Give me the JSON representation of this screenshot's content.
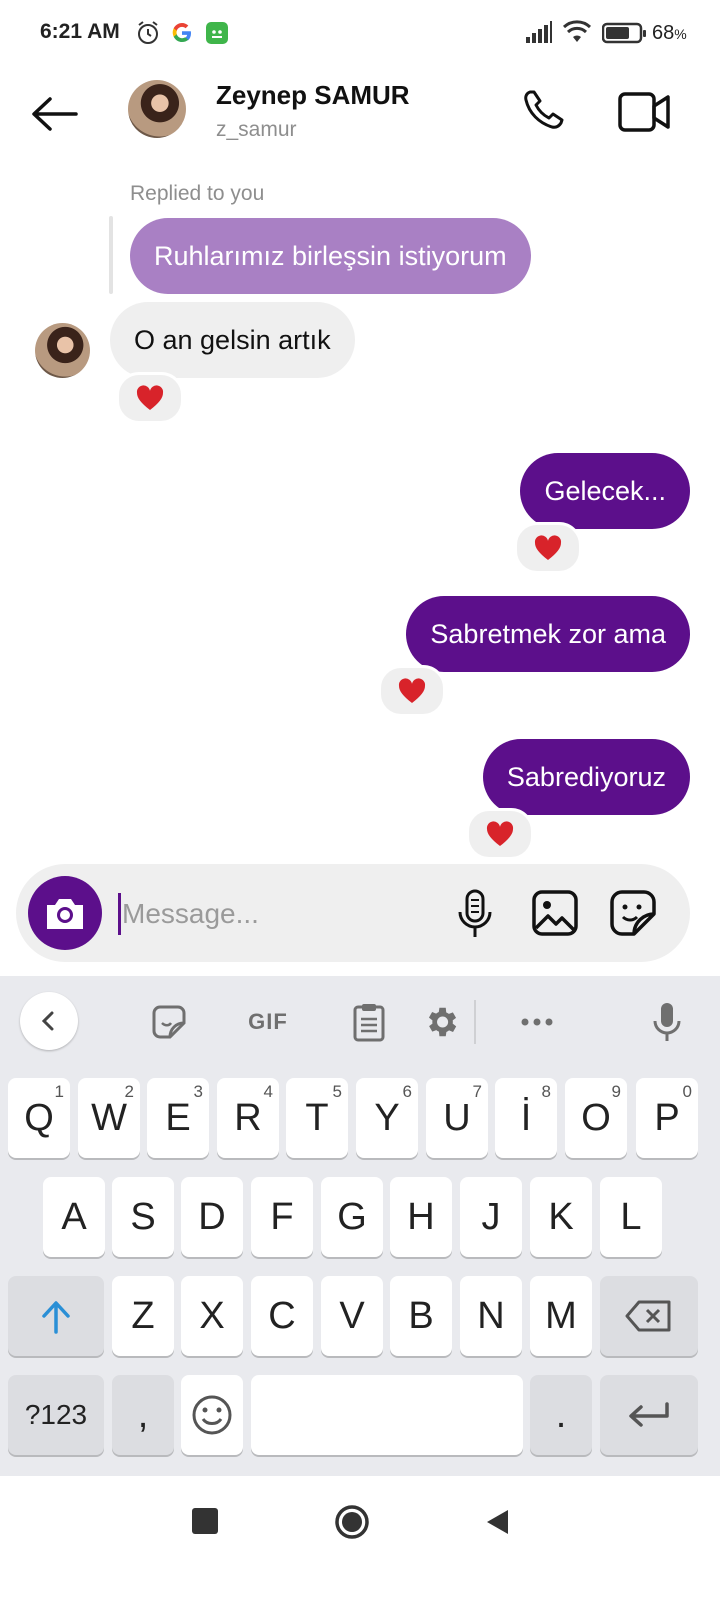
{
  "status_bar": {
    "time": "6:21 AM",
    "battery_percent": "68",
    "battery_suffix": "%",
    "battery_level": 0.68,
    "icons": [
      "alarm-icon",
      "google-icon",
      "app-notification-icon",
      "signal-icon",
      "wifi-icon",
      "battery-icon"
    ]
  },
  "header": {
    "name": "Zeynep SAMUR",
    "username": "z_samur",
    "icons": [
      "back-arrow-icon",
      "phone-icon",
      "video-camera-icon"
    ]
  },
  "messages": {
    "reply_label": "Replied to you",
    "reply_text": "Ruhlarımız birleşsin istiyorum",
    "incoming_1": "O an gelsin artık",
    "outgoing_1": "Gelecek...",
    "outgoing_2": "Sabretmek zor ama",
    "outgoing_3": "Sabrediyoruz",
    "reaction": "❤️"
  },
  "composer": {
    "placeholder": "Message...",
    "icons": [
      "camera-icon",
      "microphone-icon",
      "gallery-icon",
      "sticker-icon"
    ]
  },
  "keyboard": {
    "toolbar": {
      "gif_label": "GIF",
      "icons": [
        "chevron-left-icon",
        "sticker-icon",
        "clipboard-icon",
        "settings-icon",
        "more-icon",
        "voice-input-icon"
      ]
    },
    "row1": [
      "Q",
      "W",
      "E",
      "R",
      "T",
      "Y",
      "U",
      "İ",
      "O",
      "P"
    ],
    "row1_hints": [
      "1",
      "2",
      "3",
      "4",
      "5",
      "6",
      "7",
      "8",
      "9",
      "0"
    ],
    "row2": [
      "A",
      "S",
      "D",
      "F",
      "G",
      "H",
      "J",
      "K",
      "L"
    ],
    "row3": [
      "Z",
      "X",
      "C",
      "V",
      "B",
      "N",
      "M"
    ],
    "symbols_label": "?123",
    "comma": ",",
    "period": "."
  },
  "colors": {
    "outgoing_bubble": "#5c0f8b",
    "reply_bubble": "#a980c4",
    "incoming_bubble": "#efefef",
    "heart": "#d8232a"
  }
}
